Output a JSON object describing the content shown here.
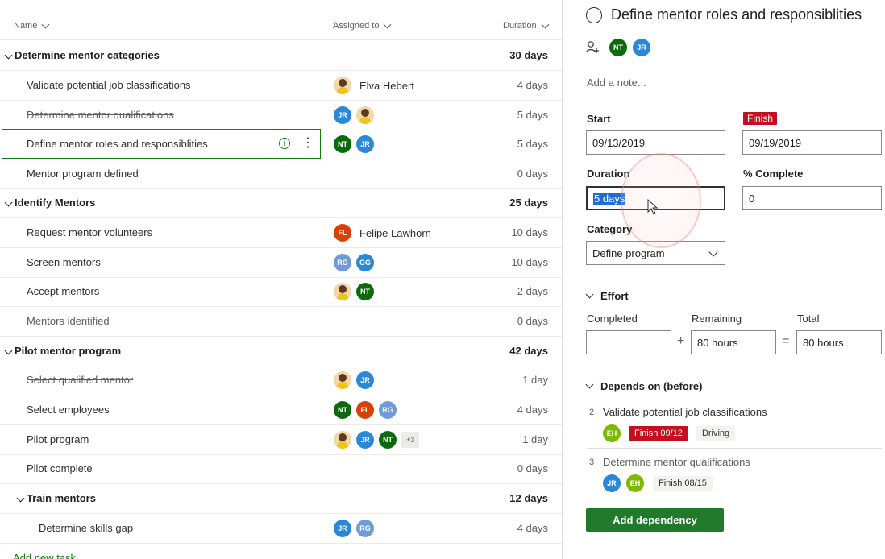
{
  "grid": {
    "columns": {
      "name": "Name",
      "assigned": "Assigned to",
      "duration": "Duration"
    },
    "rows": [
      {
        "name": "Determine mentor categories",
        "duration": "30 days"
      },
      {
        "name": "Validate potential job classifications",
        "assignee_name": "Elva Hebert",
        "duration": "4 days"
      },
      {
        "name": "Determine mentor qualifications",
        "duration": "5 days"
      },
      {
        "name": "Define mentor roles and responsiblities",
        "duration": "5 days"
      },
      {
        "name": "Mentor program defined",
        "duration": "0 days"
      },
      {
        "name": "Identify Mentors",
        "duration": "25 days"
      },
      {
        "name": "Request mentor volunteers",
        "assignee_name": "Felipe Lawhorn",
        "duration": "10 days"
      },
      {
        "name": "Screen mentors",
        "duration": "10 days"
      },
      {
        "name": "Accept mentors",
        "duration": "2 days"
      },
      {
        "name": "Mentors identified",
        "duration": "0 days"
      },
      {
        "name": "Pilot mentor program",
        "duration": "42 days"
      },
      {
        "name": "Select qualified mentor",
        "duration": "1 day"
      },
      {
        "name": "Select employees",
        "duration": "4 days"
      },
      {
        "name": "Pilot program",
        "duration": "1 day",
        "more": "+3"
      },
      {
        "name": "Pilot complete",
        "duration": "0 days"
      },
      {
        "name": "Train mentors",
        "duration": "12 days"
      },
      {
        "name": "Determine skills gap",
        "duration": "4 days"
      }
    ],
    "avatars": {
      "jr": "JR",
      "nt": "NT",
      "fl": "FL",
      "rg": "RG",
      "gg": "GG",
      "eh": "EH"
    },
    "add_task": "Add new task"
  },
  "detail": {
    "title": "Define mentor roles and responsiblities",
    "assignees": [
      "NT",
      "JR"
    ],
    "note_placeholder": "Add a note...",
    "start_label": "Start",
    "start_value": "09/13/2019",
    "finish_label": "Finish",
    "finish_value": "09/19/2019",
    "duration_label": "Duration",
    "duration_value": "5 days",
    "complete_label": "% Complete",
    "complete_value": "0",
    "category_label": "Category",
    "category_value": "Define program",
    "effort": {
      "heading": "Effort",
      "completed_label": "Completed",
      "completed_value": "",
      "remaining_label": "Remaining",
      "remaining_value": "80 hours",
      "total_label": "Total",
      "total_value": "80 hours",
      "plus": "+",
      "equals": "="
    },
    "depends": {
      "heading": "Depends on (before)",
      "items": [
        {
          "num": "2",
          "name": "Validate potential job classifications",
          "avatars": [
            "EH"
          ],
          "finish": "Finish 09/12",
          "tag": "Driving"
        },
        {
          "num": "3",
          "name": "Determine mentor qualifications",
          "avatars": [
            "JR",
            "EH"
          ],
          "finish": "Finish 08/15"
        }
      ],
      "add_button": "Add dependency"
    }
  },
  "colors": {
    "accent_green": "#107c10",
    "button_green": "#217a2b",
    "finish_red": "#c50f1f",
    "selection_blue": "#1f6fd1"
  }
}
